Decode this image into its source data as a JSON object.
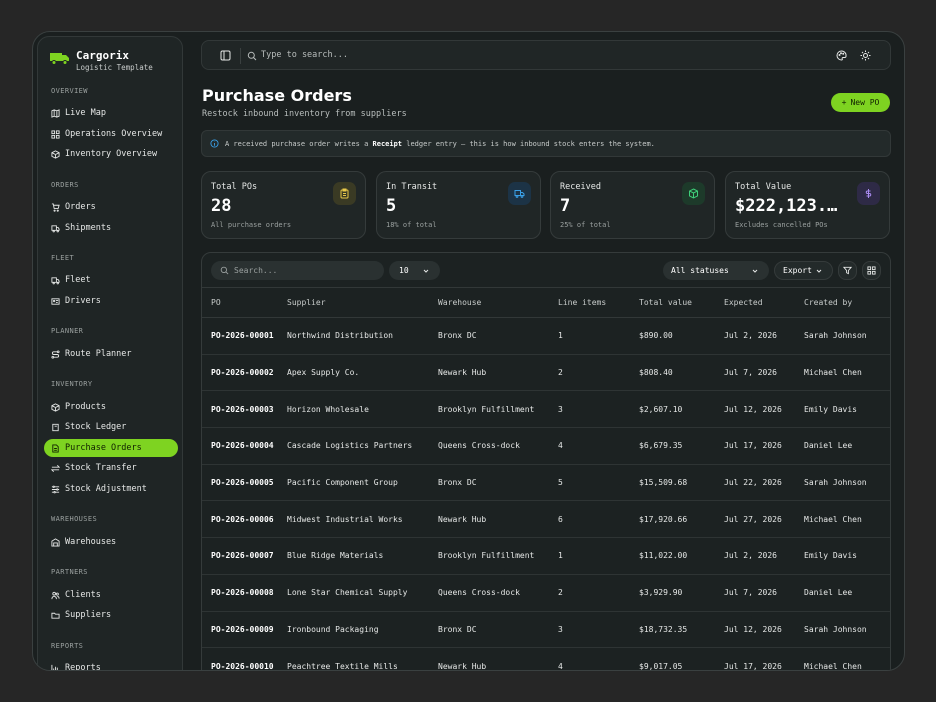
{
  "brand": {
    "name": "Cargorix",
    "tagline": "Logistic Template"
  },
  "nav": {
    "overview": {
      "title": "OVERVIEW",
      "items": [
        "Live Map",
        "Operations Overview",
        "Inventory Overview"
      ]
    },
    "orders": {
      "title": "ORDERS",
      "items": [
        "Orders",
        "Shipments"
      ]
    },
    "fleet": {
      "title": "FLEET",
      "items": [
        "Fleet",
        "Drivers"
      ]
    },
    "planner": {
      "title": "PLANNER",
      "items": [
        "Route Planner"
      ]
    },
    "inventory": {
      "title": "INVENTORY",
      "items": [
        "Products",
        "Stock Ledger",
        "Purchase Orders",
        "Stock Transfer",
        "Stock Adjustment"
      ]
    },
    "warehouses": {
      "title": "WAREHOUSES",
      "items": [
        "Warehouses"
      ]
    },
    "partners": {
      "title": "PARTNERS",
      "items": [
        "Clients",
        "Suppliers"
      ]
    },
    "reports": {
      "title": "REPORTS",
      "items": [
        "Reports"
      ]
    }
  },
  "topbar": {
    "search_placeholder": "Type to search..."
  },
  "page": {
    "title": "Purchase Orders",
    "subtitle": "Restock inbound inventory from suppliers",
    "new_button": "New PO"
  },
  "info": {
    "pre": "A received purchase order writes a",
    "bold": "Receipt",
    "post": "ledger entry — this is how inbound stock enters the system."
  },
  "cards": [
    {
      "label": "Total POs",
      "value": "28",
      "note": "All purchase orders",
      "icon": "clipboard-icon",
      "color": "#e8c84a"
    },
    {
      "label": "In Transit",
      "value": "5",
      "note": "18% of total",
      "icon": "truck-icon",
      "color": "#3aa0e8"
    },
    {
      "label": "Received",
      "value": "7",
      "note": "25% of total",
      "icon": "package-icon",
      "color": "#3fcf7a"
    },
    {
      "label": "Total Value",
      "value": "$222,123.…",
      "note": "Excludes cancelled POs",
      "icon": "dollar-icon",
      "color": "#a98bf0"
    }
  ],
  "toolbar": {
    "search_placeholder": "Search...",
    "page_size": "10",
    "status_filter": "All statuses",
    "export_label": "Export"
  },
  "table": {
    "columns": [
      "PO",
      "Supplier",
      "Warehouse",
      "Line items",
      "Total value",
      "Expected",
      "Created by"
    ],
    "rows": [
      [
        "PO-2026-00001",
        "Northwind Distribution",
        "Bronx DC",
        "1",
        "$890.00",
        "Jul 2, 2026",
        "Sarah Johnson"
      ],
      [
        "PO-2026-00002",
        "Apex Supply Co.",
        "Newark Hub",
        "2",
        "$808.40",
        "Jul 7, 2026",
        "Michael Chen"
      ],
      [
        "PO-2026-00003",
        "Horizon Wholesale",
        "Brooklyn Fulfillment",
        "3",
        "$2,607.10",
        "Jul 12, 2026",
        "Emily Davis"
      ],
      [
        "PO-2026-00004",
        "Cascade Logistics Partners",
        "Queens Cross-dock",
        "4",
        "$6,679.35",
        "Jul 17, 2026",
        "Daniel Lee"
      ],
      [
        "PO-2026-00005",
        "Pacific Component Group",
        "Bronx DC",
        "5",
        "$15,509.68",
        "Jul 22, 2026",
        "Sarah Johnson"
      ],
      [
        "PO-2026-00006",
        "Midwest Industrial Works",
        "Newark Hub",
        "6",
        "$17,920.66",
        "Jul 27, 2026",
        "Michael Chen"
      ],
      [
        "PO-2026-00007",
        "Blue Ridge Materials",
        "Brooklyn Fulfillment",
        "1",
        "$11,022.00",
        "Jul 2, 2026",
        "Emily Davis"
      ],
      [
        "PO-2026-00008",
        "Lone Star Chemical Supply",
        "Queens Cross-dock",
        "2",
        "$3,929.90",
        "Jul 7, 2026",
        "Daniel Lee"
      ],
      [
        "PO-2026-00009",
        "Ironbound Packaging",
        "Bronx DC",
        "3",
        "$18,732.35",
        "Jul 12, 2026",
        "Sarah Johnson"
      ],
      [
        "PO-2026-00010",
        "Peachtree Textile Mills",
        "Newark Hub",
        "4",
        "$9,017.05",
        "Jul 17, 2026",
        "Michael Chen"
      ]
    ]
  },
  "colors": {
    "accent": "#7ed321"
  }
}
